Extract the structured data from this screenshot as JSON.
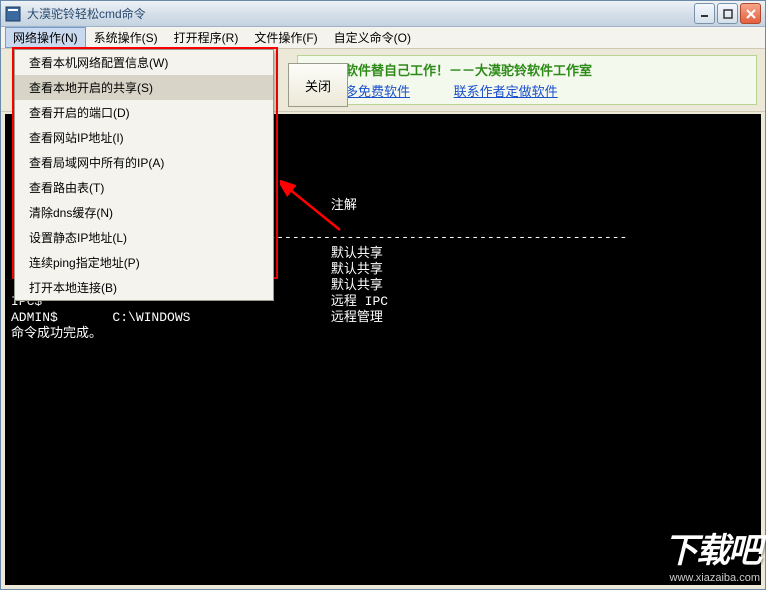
{
  "titlebar": {
    "text": "大漠驼铃轻松cmd命令"
  },
  "menubar": {
    "items": [
      {
        "label": "网络操作(N)"
      },
      {
        "label": "系统操作(S)"
      },
      {
        "label": "打开程序(R)"
      },
      {
        "label": "文件操作(F)"
      },
      {
        "label": "自定义命令(O)"
      }
    ]
  },
  "dropdown": {
    "items": [
      {
        "label": "查看本机网络配置信息(W)"
      },
      {
        "label": "查看本地开启的共享(S)"
      },
      {
        "label": "查看开启的端口(D)"
      },
      {
        "label": "查看网站IP地址(I)"
      },
      {
        "label": "查看局域网中所有的IP(A)"
      },
      {
        "label": "查看路由表(T)"
      },
      {
        "label": "清除dns缓存(N)"
      },
      {
        "label": "设置静态IP地址(L)"
      },
      {
        "label": "连续ping指定地址(P)"
      },
      {
        "label": "打开本地连接(B)"
      }
    ]
  },
  "toolbar": {
    "close_label": "关闭"
  },
  "promo": {
    "title": "智者用软件替自己工作！－－大漠驼铃软件工作室",
    "link1": "下载更多免费软件",
    "link2": "联系作者定做软件"
  },
  "terminal": {
    "content": "\n\n\n\n\n                                         注解\n\n-------------------------------------------------------------------------------\n                                         默认共享\n                                         默认共享\n                                         默认共享\nIPC$                                     远程 IPC\nADMIN$       C:\\WINDOWS                  远程管理\n命令成功完成。\n"
  },
  "watermark": {
    "main": "下载吧",
    "url": "www.xiazaiba.com"
  }
}
